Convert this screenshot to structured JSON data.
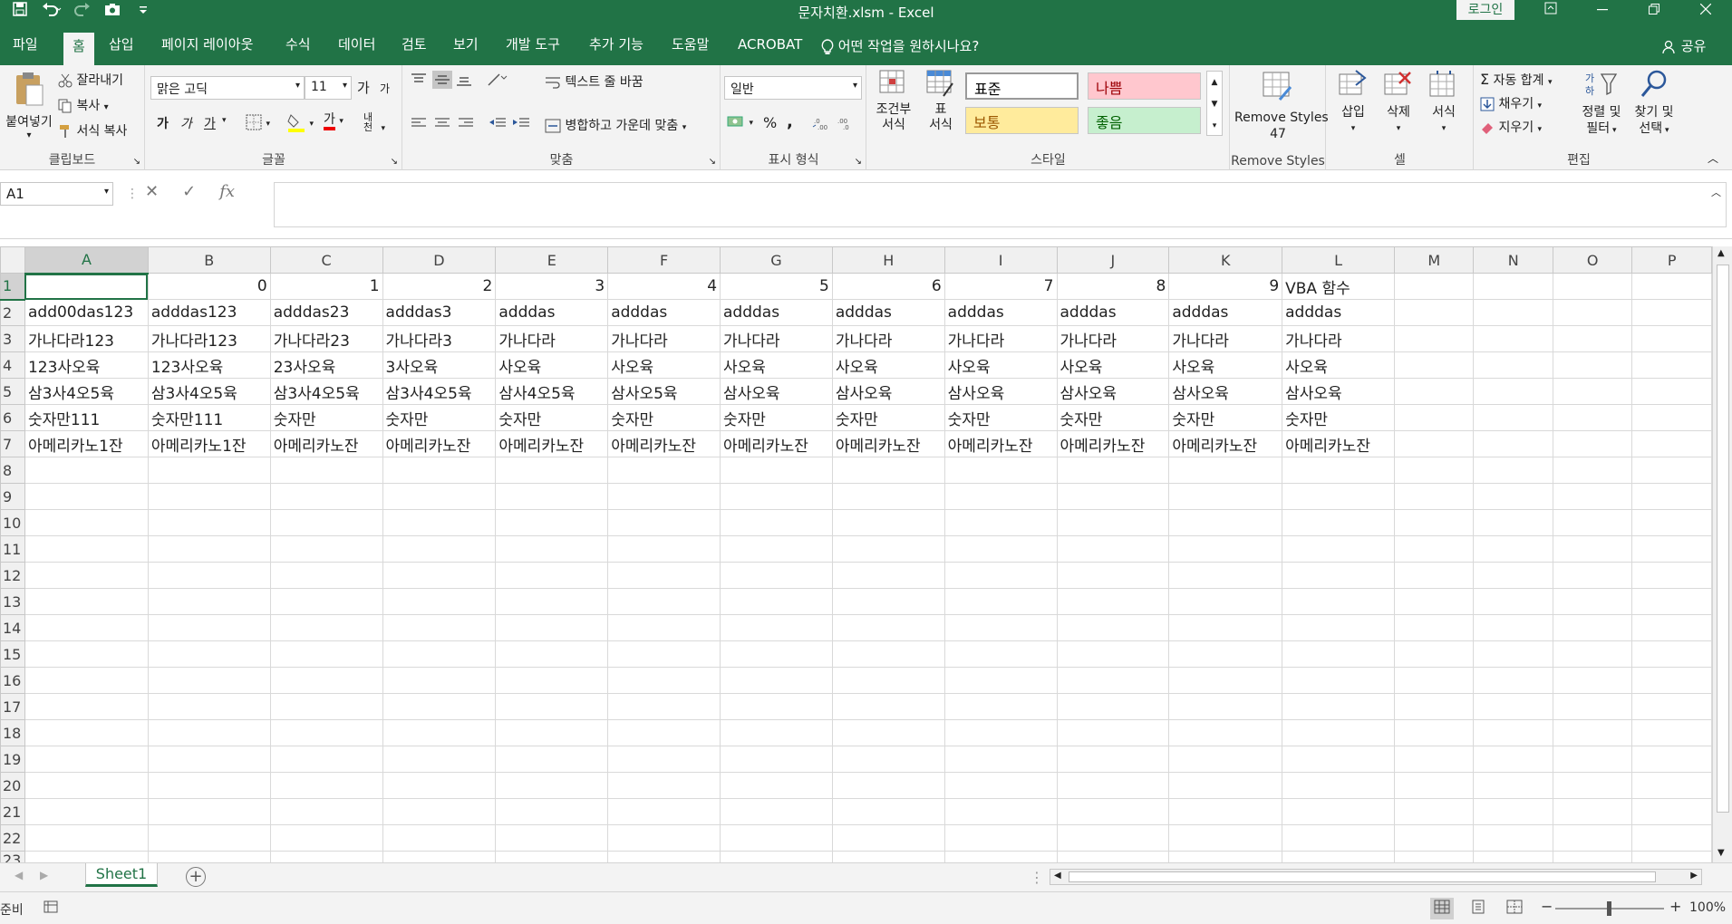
{
  "window": {
    "title": "문자치환.xlsm  -  Excel",
    "login_label": "로그인",
    "qat_icons": [
      "save-icon",
      "undo-icon",
      "redo-icon",
      "camera-icon",
      "customize-icon"
    ]
  },
  "tabs": [
    "파일",
    "홈",
    "삽입",
    "페이지 레이아웃",
    "수식",
    "데이터",
    "검토",
    "보기",
    "개발 도구",
    "추가 기능",
    "도움말",
    "ACROBAT"
  ],
  "active_tab": "홈",
  "tell_me": "어떤 작업을 원하시나요?",
  "share_label": "공유",
  "ribbon": {
    "clipboard": {
      "paste": "붙여넣기",
      "cut": "잘라내기",
      "copy": "복사",
      "format_painter": "서식 복사",
      "group_label": "클립보드"
    },
    "font": {
      "font_name": "맑은 고딕",
      "font_size": "11",
      "grow": "가",
      "shrink": "가",
      "bold": "가",
      "italic": "가",
      "underline": "가",
      "font_color_glyph": "가",
      "phonetic_glyph": "내천",
      "group_label": "글꼴"
    },
    "alignment": {
      "wrap_text": "텍스트 줄 바꿈",
      "merge_center": "병합하고 가운데 맞춤",
      "group_label": "맞춤"
    },
    "number": {
      "format": "일반",
      "percent": "%",
      "comma": ",",
      "group_label": "표시 형식"
    },
    "styles": {
      "conditional": [
        "조건부",
        "서식"
      ],
      "table": [
        "표",
        "서식"
      ],
      "cells": [
        {
          "label": "표준",
          "bg": "#ffffff",
          "color": "#000000"
        },
        {
          "label": "나쁨",
          "bg": "#ffc7ce",
          "color": "#9c0006"
        },
        {
          "label": "보통",
          "bg": "#ffeb9c",
          "color": "#9c5700"
        },
        {
          "label": "좋음",
          "bg": "#c6efce",
          "color": "#006100"
        }
      ],
      "group_label": "스타일"
    },
    "remove_styles": {
      "button": [
        "Remove Styles",
        "47"
      ],
      "group_label": "Remove Styles"
    },
    "cells_group": {
      "insert": "삽입",
      "delete": "삭제",
      "format": "서식",
      "group_label": "셀"
    },
    "editing": {
      "autosum": "자동 합계",
      "fill": "채우기",
      "clear": "지우기",
      "sort_filter": [
        "정렬 및",
        "필터"
      ],
      "find_select": [
        "찾기 및",
        "선택"
      ],
      "group_label": "편집"
    }
  },
  "formula_bar": {
    "name_box": "A1",
    "cancel": "✕",
    "enter": "✓",
    "fx": "fx",
    "formula": ""
  },
  "sheet": {
    "columns": [
      "A",
      "B",
      "C",
      "D",
      "E",
      "F",
      "G",
      "H",
      "I",
      "J",
      "K",
      "L",
      "M",
      "N",
      "O",
      "P"
    ],
    "rows": [
      [
        "",
        "0",
        "1",
        "2",
        "3",
        "4",
        "5",
        "6",
        "7",
        "8",
        "9",
        "VBA 함수",
        "",
        "",
        "",
        ""
      ],
      [
        "add00das123",
        "adddas123",
        "adddas23",
        "adddas3",
        "adddas",
        "adddas",
        "adddas",
        "adddas",
        "adddas",
        "adddas",
        "adddas",
        "adddas",
        "",
        "",
        "",
        ""
      ],
      [
        "가나다라123",
        "가나다라123",
        "가나다라23",
        "가나다라3",
        "가나다라",
        "가나다라",
        "가나다라",
        "가나다라",
        "가나다라",
        "가나다라",
        "가나다라",
        "가나다라",
        "",
        "",
        "",
        ""
      ],
      [
        "123사오육",
        "123사오육",
        "23사오육",
        "3사오육",
        "사오육",
        "사오육",
        "사오육",
        "사오육",
        "사오육",
        "사오육",
        "사오육",
        "사오육",
        "",
        "",
        "",
        ""
      ],
      [
        "삼3사4오5육",
        "삼3사4오5육",
        "삼3사4오5육",
        "삼3사4오5육",
        "삼사4오5육",
        "삼사오5육",
        "삼사오육",
        "삼사오육",
        "삼사오육",
        "삼사오육",
        "삼사오육",
        "삼사오육",
        "",
        "",
        "",
        ""
      ],
      [
        "숫자만111",
        "숫자만111",
        "숫자만",
        "숫자만",
        "숫자만",
        "숫자만",
        "숫자만",
        "숫자만",
        "숫자만",
        "숫자만",
        "숫자만",
        "숫자만",
        "",
        "",
        "",
        ""
      ],
      [
        "아메리카노1잔",
        "아메리카노1잔",
        "아메리카노잔",
        "아메리카노잔",
        "아메리카노잔",
        "아메리카노잔",
        "아메리카노잔",
        "아메리카노잔",
        "아메리카노잔",
        "아메리카노잔",
        "아메리카노잔",
        "아메리카노잔",
        "",
        "",
        "",
        ""
      ]
    ],
    "total_visible_rows": 23,
    "active_cell": "A1"
  },
  "sheet_tabs": [
    "Sheet1"
  ],
  "status": {
    "ready": "준비",
    "zoom": "100%"
  },
  "colors": {
    "accent": "#217346"
  }
}
